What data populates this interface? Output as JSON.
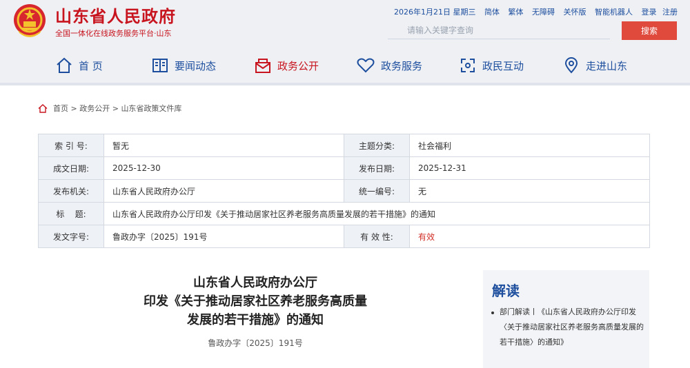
{
  "header": {
    "site_title": "山东省人民政府",
    "site_subtitle": "全国一体化在线政务服务平台·山东",
    "top_links": [
      "2026年1月21日 星期三",
      "简体",
      "繁体",
      "无障碍",
      "关怀版",
      "智能机器人",
      "登录",
      "注册"
    ],
    "search_placeholder": "请输入关键字查询",
    "search_button": "搜索"
  },
  "nav": [
    {
      "label": "首 页",
      "icon": "home-icon"
    },
    {
      "label": "要闻动态",
      "icon": "news-icon"
    },
    {
      "label": "政务公开",
      "icon": "mail-icon",
      "active": true
    },
    {
      "label": "政务服务",
      "icon": "heart-icon"
    },
    {
      "label": "政民互动",
      "icon": "interaction-icon"
    },
    {
      "label": "走进山东",
      "icon": "location-icon"
    }
  ],
  "breadcrumb": [
    "首页",
    "政务公开",
    "山东省政策文件库"
  ],
  "meta": {
    "index_label": "索 引 号:",
    "index_value": "暂无",
    "category_label": "主题分类:",
    "category_value": "社会福利",
    "written_label": "成文日期:",
    "written_value": "2025-12-30",
    "published_label": "发布日期:",
    "published_value": "2025-12-31",
    "issuer_label": "发布机关:",
    "issuer_value": "山东省人民政府办公厅",
    "code_label": "统一编号:",
    "code_value": "无",
    "title_label": "标    题:",
    "title_value": "山东省人民政府办公厅印发《关于推动居家社区养老服务高质量发展的若干措施》的通知",
    "docno_label": "发文字号:",
    "docno_value": "鲁政办字〔2025〕191号",
    "validity_label": "有 效 性:",
    "validity_value": "有效"
  },
  "document": {
    "title_line1": "山东省人民政府办公厅",
    "title_line2": "印发《关于推动居家社区养老服务高质量",
    "title_line3": "发展的若干措施》的通知",
    "doc_number": "鲁政办字〔2025〕191号"
  },
  "side": {
    "title": "解读",
    "item": "部门解读丨《山东省人民政府办公厅印发〈关于推动居家社区养老服务高质量发展的若干措施〉的通知》"
  },
  "colors": {
    "brand_red": "#c8141e",
    "nav_blue": "#1d4e9e",
    "search_button": "#df4a3c"
  }
}
